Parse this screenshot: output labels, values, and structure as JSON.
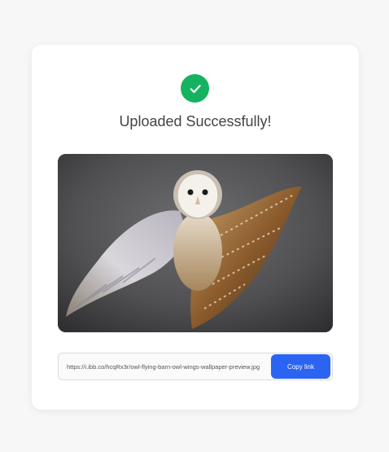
{
  "status": {
    "icon": "check-circle-icon",
    "title": "Uploaded Successfully!",
    "color": "#15b361"
  },
  "image": {
    "subject": "owl-flying-photo"
  },
  "share": {
    "link_value": "https://i.ibb.co/hcqRx3r/owl-flying-barn-owl-wings-wallpaper-preview.jpg",
    "copy_label": "Copy link",
    "button_color": "#2b64f2"
  }
}
